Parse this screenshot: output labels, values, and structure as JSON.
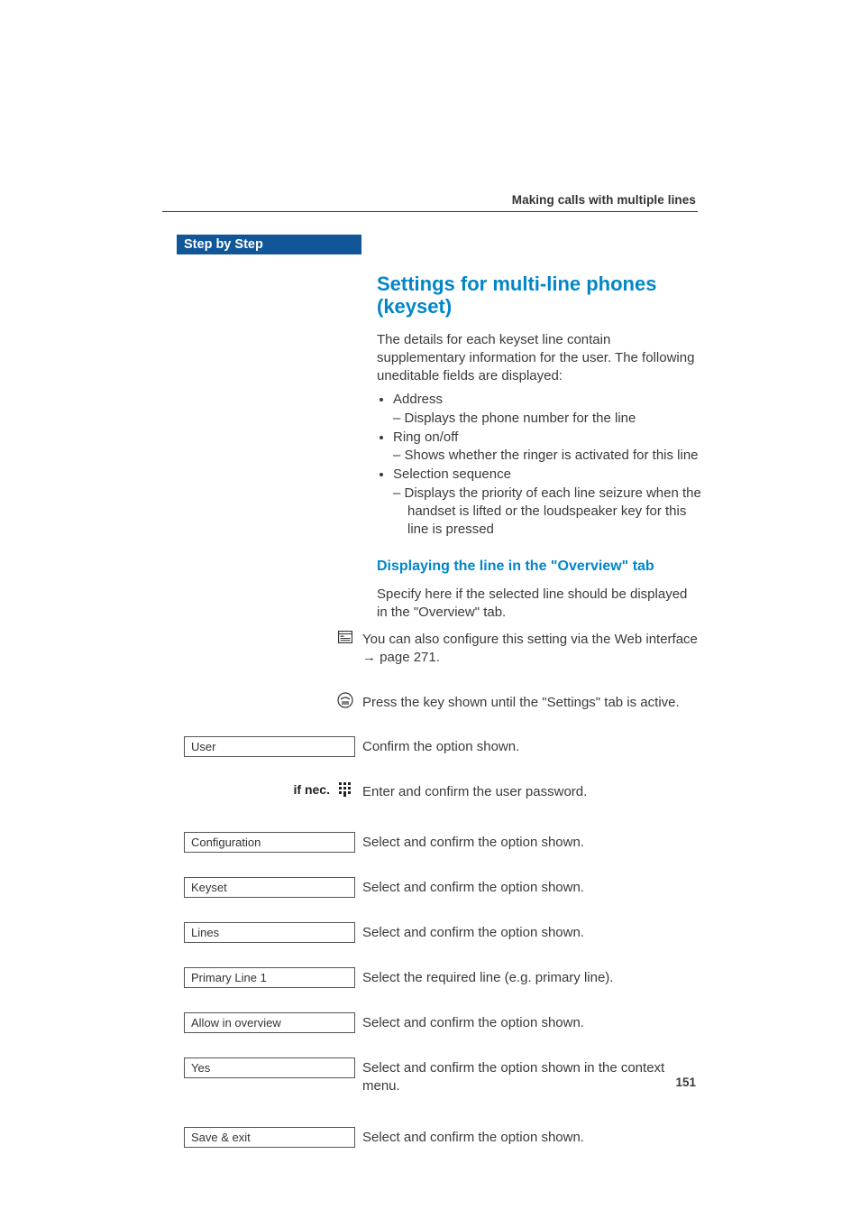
{
  "header": {
    "running_head": "Making calls with multiple lines"
  },
  "sidebar": {
    "title": "Step by Step"
  },
  "main": {
    "title": "Settings for multi-line phones (keyset)",
    "intro": "The details for each keyset line contain supplementary information for the user. The following uneditable fields are displayed:",
    "fields": [
      {
        "name": "Address",
        "desc": "Displays the phone number for the line"
      },
      {
        "name": "Ring on/off",
        "desc": "Shows whether the ringer is activated for this line"
      },
      {
        "name": "Selection sequence",
        "desc": "Displays the priority of each line seizure when the handset is lifted or the loudspeaker key for this line is pressed"
      }
    ],
    "subheading": "Displaying the line in the \"Overview\" tab",
    "sub_intro": "Specify here if the selected line should be displayed in the \"Overview\" tab.",
    "web_note_prefix": "You can also configure this setting via the Web interface ",
    "web_note_link": "→ page 271.",
    "settings_key_note": "Press the key shown until the \"Settings\" tab is active."
  },
  "steps": [
    {
      "left_type": "icon",
      "left_icon": "web-icon",
      "right": "__web_note__"
    },
    {
      "left_type": "icon",
      "left_icon": "settings-key-icon",
      "right": "__settings_key__"
    },
    {
      "left_type": "option",
      "left_label": "User",
      "right": "Confirm the option shown."
    },
    {
      "left_type": "ifnec",
      "left_label": "if nec.",
      "left_icon": "keypad-icon",
      "right": "Enter and confirm the user password."
    },
    {
      "left_type": "option",
      "left_label": "Configuration",
      "right": "Select and confirm the option shown."
    },
    {
      "left_type": "option",
      "left_label": "Keyset",
      "right": "Select and confirm the option shown."
    },
    {
      "left_type": "option",
      "left_label": "Lines",
      "right": "Select and confirm the option shown."
    },
    {
      "left_type": "option",
      "left_label": "Primary Line 1",
      "right": "Select the required line (e.g. primary line)."
    },
    {
      "left_type": "option",
      "left_label": "Allow in overview",
      "right": "Select and confirm the option shown."
    },
    {
      "left_type": "option",
      "left_label": "Yes",
      "right": "Select and confirm the option shown in the context menu."
    },
    {
      "left_type": "option",
      "left_label": "Save & exit",
      "right": "Select and confirm the option shown."
    }
  ],
  "page_number": "151",
  "icons": {
    "web-icon": "web-page-icon",
    "settings-key-icon": "settings-key-icon",
    "keypad-icon": "keypad-icon"
  }
}
